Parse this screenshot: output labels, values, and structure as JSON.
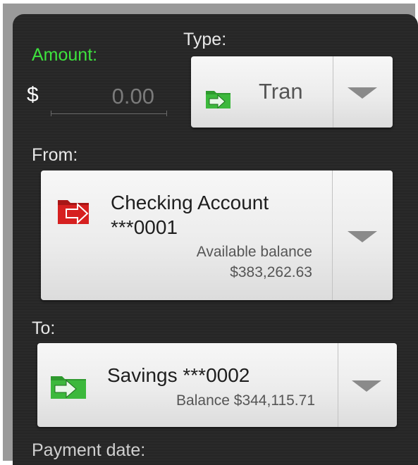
{
  "amount": {
    "label": "Amount:",
    "currency_symbol": "$",
    "placeholder": "0.00"
  },
  "type": {
    "label": "Type:",
    "value": "Tran",
    "icon": "transfer-folder-icon"
  },
  "from": {
    "label": "From:",
    "account_name": "Checking Account",
    "account_number": "***0001",
    "balance_label": "Available balance",
    "balance_value": "$383,262.63",
    "icon": "outgoing-folder-icon"
  },
  "to": {
    "label": "To:",
    "account": "Savings ***0002",
    "balance": "Balance $344,115.71",
    "icon": "incoming-folder-icon"
  },
  "payment_date": {
    "label": "Payment date:"
  },
  "colors": {
    "accent_green": "#3ee23e",
    "icon_green": "#3cb83c",
    "icon_red": "#d62020"
  }
}
